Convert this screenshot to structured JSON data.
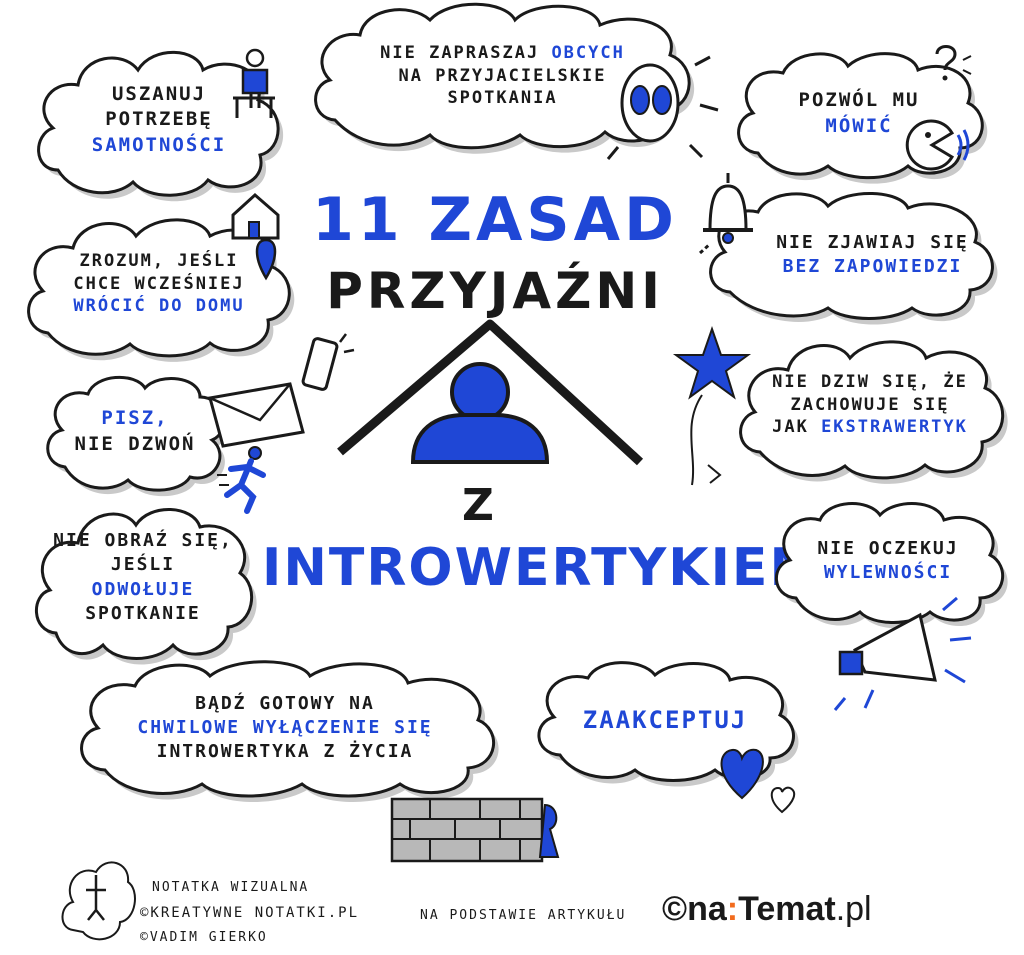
{
  "title": {
    "line1": "11 ZASAD",
    "line2": "PRZYJAŹNI",
    "line3": "Z",
    "line4": "INTROWERTYKIEM."
  },
  "rules": [
    {
      "id": "rule-solitude",
      "lines": [
        {
          "t": "USZANUJ",
          "blue": false
        },
        {
          "t": "POTRZEBĘ",
          "blue": false
        },
        {
          "t": "SAMOTNOŚCI",
          "blue": true
        }
      ]
    },
    {
      "id": "rule-strangers",
      "lines": [
        {
          "t": "NIE ZAPRASZAJ",
          "blue": false,
          "tail": " OBCYCH",
          "tailBlue": true
        },
        {
          "t": "NA PRZYJACIELSKIE",
          "blue": false
        },
        {
          "t": "SPOTKANIA",
          "blue": false
        }
      ]
    },
    {
      "id": "rule-let-talk",
      "lines": [
        {
          "t": "POZWÓL MU",
          "blue": false
        },
        {
          "t": "MÓWIĆ",
          "blue": true
        }
      ]
    },
    {
      "id": "rule-go-home",
      "lines": [
        {
          "t": "ZROZUM, JEŚLI",
          "blue": false
        },
        {
          "t": "CHCE WCZEŚNIEJ",
          "blue": false
        },
        {
          "t": "WRÓCIĆ DO DOMU",
          "blue": true
        }
      ]
    },
    {
      "id": "rule-no-surprise",
      "lines": [
        {
          "t": "NIE ZJAWIAJ SIĘ",
          "blue": false
        },
        {
          "t": "BEZ ZAPOWIEDZI",
          "blue": true
        }
      ]
    },
    {
      "id": "rule-write",
      "lines": [
        {
          "t": "PISZ,",
          "blue": true
        },
        {
          "t": "NIE DZWOŃ",
          "blue": false
        }
      ]
    },
    {
      "id": "rule-extrovert",
      "lines": [
        {
          "t": "NIE DZIW SIĘ, ŻE",
          "blue": false
        },
        {
          "t": "ZACHOWUJE SIĘ",
          "blue": false
        },
        {
          "t": "JAK",
          "blue": false,
          "tail": " EKSTRAWERTYK",
          "tailBlue": true
        }
      ]
    },
    {
      "id": "rule-cancel",
      "lines": [
        {
          "t": "NIE OBRAŹ SIĘ,",
          "blue": false
        },
        {
          "t": "JEŚLI",
          "blue": false
        },
        {
          "t": "ODWOŁUJE",
          "blue": true
        },
        {
          "t": "SPOTKANIE",
          "blue": false
        }
      ]
    },
    {
      "id": "rule-openness",
      "lines": [
        {
          "t": "NIE OCZEKUJ",
          "blue": false
        },
        {
          "t": "WYLEWNOŚCI",
          "blue": true
        }
      ]
    },
    {
      "id": "rule-switch-off",
      "lines": [
        {
          "t": "BĄDŹ GOTOWY NA",
          "blue": false
        },
        {
          "t": "CHWILOWE WYŁĄCZENIE SIĘ",
          "blue": true
        },
        {
          "t": "INTROWERTYKA Z ŻYCIA",
          "blue": false
        }
      ]
    },
    {
      "id": "rule-accept",
      "lines": [
        {
          "t": "ZAAKCEPTUJ",
          "blue": true
        }
      ]
    }
  ],
  "footer": {
    "note": "NOTATKA WIZUALNA",
    "site": "©KREATYWNE NOTATKI.PL",
    "author": "©VADIM GIERKO",
    "source_label": "NA PODSTAWIE ARTYKUŁU",
    "brand_copy": "©",
    "brand_na": "na",
    "brand_colon": ":",
    "brand_temat": "Temat",
    "brand_tld": ".pl"
  },
  "colors": {
    "accent": "#1f47d6",
    "ink": "#1a1a1a",
    "shadow": "#c9c9c9",
    "brand_orange": "#f26b1d"
  },
  "icons": [
    "chair-person-icon",
    "alien-icon",
    "pacman-speaker-icon",
    "house-pin-icon",
    "bell-icon",
    "phone-icon",
    "envelope-icon",
    "running-person-icon",
    "star-icon",
    "person-silhouette-icon",
    "roof-icon",
    "megaphone-icon",
    "brick-wall-icon",
    "heart-icon",
    "logo-icon"
  ]
}
